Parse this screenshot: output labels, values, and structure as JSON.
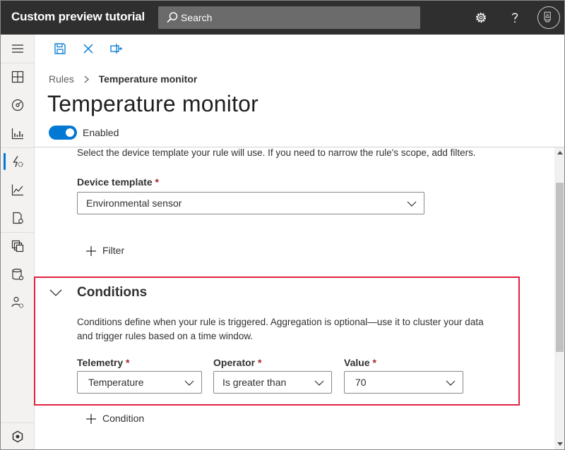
{
  "app": {
    "title": "Custom preview tutorial"
  },
  "search": {
    "placeholder": "Search"
  },
  "topbar_icons": [
    "gear-icon",
    "help-icon",
    "user-avatar-icon"
  ],
  "nav": {
    "items": [
      {
        "name": "menu-icon"
      },
      {
        "name": "dashboard-icon"
      },
      {
        "name": "devices-icon"
      },
      {
        "name": "device-groups-icon"
      },
      {
        "name": "rules-icon",
        "active": true
      },
      {
        "name": "analytics-icon"
      },
      {
        "name": "jobs-icon"
      },
      {
        "name": "device-templates-icon"
      },
      {
        "name": "data-export-icon"
      },
      {
        "name": "administration-icon"
      },
      {
        "name": "iot-central-icon"
      }
    ]
  },
  "command_bar": [
    "save-icon",
    "close-icon",
    "test-icon"
  ],
  "breadcrumb": {
    "parent": "Rules",
    "current": "Temperature monitor"
  },
  "page": {
    "title": "Temperature monitor",
    "toggle_label": "Enabled",
    "enabled": true
  },
  "scope": {
    "description": "Select the device template your rule will use. If you need to narrow the rule's scope, add filters.",
    "device_template_label": "Device template",
    "device_template_value": "Environmental sensor",
    "filter_button": "Filter"
  },
  "conditions": {
    "title": "Conditions",
    "description_line1": "Conditions define when your rule is triggered. Aggregation is optional—use it to cluster your data",
    "description_line2": "and trigger rules based on a time window.",
    "telemetry_label": "Telemetry",
    "telemetry_value": "Temperature",
    "operator_label": "Operator",
    "operator_value": "Is greater than",
    "value_label": "Value",
    "value_value": "70",
    "required_mark": "*",
    "add_condition_button": "Condition"
  },
  "colors": {
    "accent": "#0078d4",
    "topbar": "#2f2f2f",
    "highlight": "#e0223d"
  }
}
